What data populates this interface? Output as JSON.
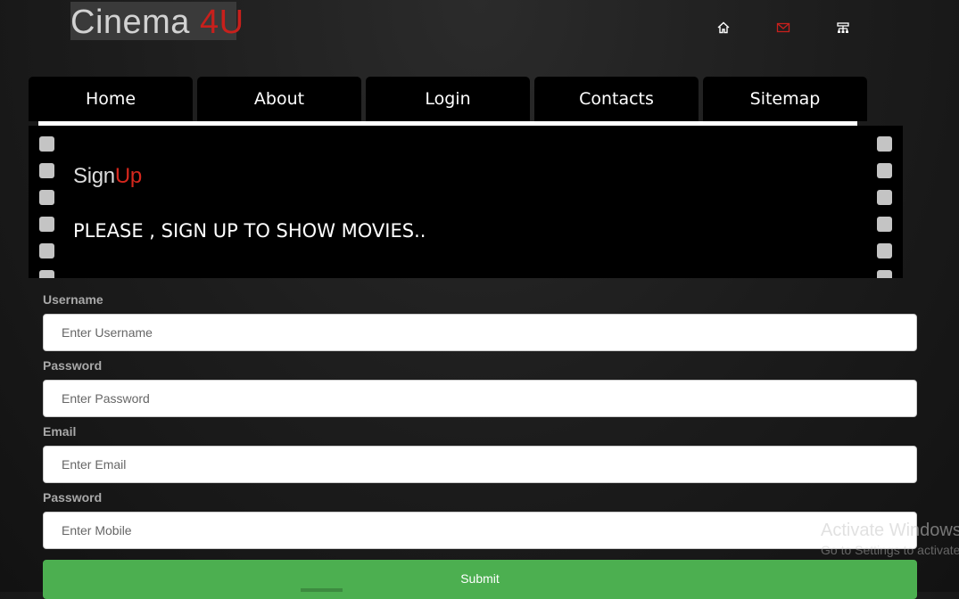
{
  "logo": {
    "text_main": "Cinema ",
    "text_accent": "4U",
    "accent_color": "#c8201c"
  },
  "top_icons": [
    {
      "name": "home-icon"
    },
    {
      "name": "mail-icon",
      "color": "#c8201c"
    },
    {
      "name": "sitemap-icon"
    }
  ],
  "nav": {
    "items": [
      {
        "label": "Home"
      },
      {
        "label": "About"
      },
      {
        "label": "Login"
      },
      {
        "label": "Contacts"
      },
      {
        "label": "Sitemap"
      }
    ]
  },
  "banner": {
    "title_a": "Sign",
    "title_b": "Up",
    "message": "PLEASE , SIGN UP TO SHOW MOVIES.."
  },
  "form": {
    "fields": [
      {
        "label": "Username",
        "placeholder": "Enter Username",
        "value": ""
      },
      {
        "label": "Password",
        "placeholder": "Enter Password",
        "value": ""
      },
      {
        "label": "Email",
        "placeholder": "Enter Email",
        "value": ""
      },
      {
        "label": "Password",
        "placeholder": "Enter Mobile",
        "value": ""
      }
    ],
    "submit_label": "Submit",
    "submit_color": "#4caf50"
  },
  "watermark": {
    "title": "Activate Windows",
    "subtitle": "Go to Settings to activate Windows."
  }
}
